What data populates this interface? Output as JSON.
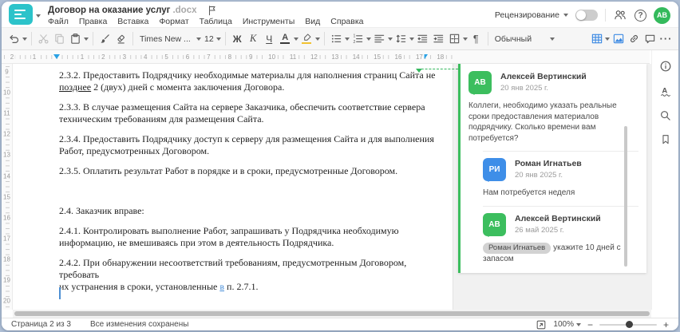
{
  "window": {
    "title": "Договор на оказание услуг",
    "title_ext": ".docx"
  },
  "menubar": {
    "items": [
      "Файл",
      "Правка",
      "Вставка",
      "Формат",
      "Таблица",
      "Инструменты",
      "Вид",
      "Справка"
    ]
  },
  "topbar_right": {
    "review_label": "Рецензирование",
    "avatar_initials": "АВ",
    "avatar_color": "#34ba5c"
  },
  "toolbar": {
    "font_name": "Times New ...",
    "font_size": "12",
    "bold_label": "Ж",
    "italic_label": "К",
    "underline_label": "Ч",
    "font_color_label": "А",
    "style_name": "Обычный",
    "pilcrow": "¶",
    "more_label": "···"
  },
  "ruler": {
    "h_left_numbers": [
      "2",
      "1"
    ],
    "h_numbers": [
      "1",
      "2",
      "3",
      "4",
      "5",
      "6",
      "7",
      "8",
      "9",
      "10",
      "11",
      "12",
      "13",
      "14",
      "15",
      "16",
      "17",
      "18"
    ],
    "v_numbers": [
      "9",
      "10",
      "11",
      "12",
      "13",
      "14",
      "15",
      "16",
      "17",
      "18",
      "19",
      "20"
    ]
  },
  "document": {
    "paragraphs": [
      {
        "runs": [
          {
            "t": "2.3.2. Предоставить Подрядчику необходимые материалы для наполнения страниц Сайта не\n"
          },
          {
            "t": "позднее",
            "s": "u"
          },
          {
            "t": " 2 (двух) дней с момента заключения Договора."
          }
        ]
      },
      {
        "runs": [
          {
            "t": "2.3.3. В случае размещения Сайта на сервере Заказчика, обеспечить соответствие сервера\nтехническим требованиям для размещения Сайта."
          }
        ]
      },
      {
        "runs": [
          {
            "t": "2.3.4. Предоставить Подрядчику доступ к серверу для размещения Сайта и для выполнения\nРабот, предусмотренных Договором."
          }
        ]
      },
      {
        "runs": [
          {
            "t": "2.3.5. Оплатить результат Работ в порядке и в сроки, предусмотренные Договором."
          }
        ]
      },
      {
        "runs": [
          {
            "t": ""
          }
        ]
      },
      {
        "runs": [
          {
            "t": "2.4. Заказчик вправе:"
          }
        ]
      },
      {
        "runs": [
          {
            "t": "2.4.1. Контролировать выполнение Работ, запрашивать у Подрядчика необходимую\nинформацию, не вмешиваясь при этом в деятельность Подрядчика."
          }
        ]
      },
      {
        "runs": [
          {
            "t": "2.4.2. При обнаружении несоответствий требованиям, предусмотренным Договором, требовать\nих устранения в сроки, установленные "
          },
          {
            "t": "в",
            "s": "lnk"
          },
          {
            "t": " п. 2.7.1."
          }
        ]
      }
    ]
  },
  "comments": {
    "thread": [
      {
        "initials": "АВ",
        "color": "#3cbe5e",
        "author": "Алексей Вертинский",
        "date": "20 янв 2025 г.",
        "text": "Коллеги, необходимо указать реальные сроки предоставления материалов подрядчику. Сколько времени вам потребуется?",
        "reply": false
      },
      {
        "initials": "РИ",
        "color": "#3e8ee8",
        "author": "Роман Игнатьев",
        "date": "20 янв 2025 г.",
        "text": "Нам потребуется неделя",
        "reply": true
      },
      {
        "initials": "АВ",
        "color": "#3cbe5e",
        "author": "Алексей Вертинский",
        "date": "26 май 2025 г.",
        "mention": "Роман Игнатьев",
        "text": "укажите 10 дней с запасом",
        "reply": true
      }
    ]
  },
  "statusbar": {
    "page_info": "Страница 2 из 3",
    "save_status": "Все изменения сохранены",
    "zoom_value": "100%",
    "zoom_out": "−",
    "zoom_in": "+",
    "help_glyph": "?"
  },
  "colors": {
    "accent_teal": "#2cc3ca",
    "accent_blue": "#3d8ae3",
    "comment_green": "#3cbe5e",
    "comment_blue": "#3e8ee8"
  }
}
